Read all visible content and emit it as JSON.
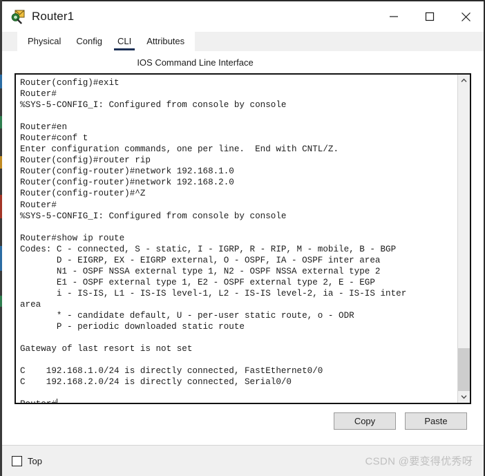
{
  "window": {
    "title": "Router1",
    "icon": "packet-tracer-device-icon",
    "controls": {
      "minimize": "minimize-icon",
      "maximize": "maximize-icon",
      "close": "close-icon"
    }
  },
  "tabs": [
    {
      "label": "Physical",
      "active": false
    },
    {
      "label": "Config",
      "active": false
    },
    {
      "label": "CLI",
      "active": true
    },
    {
      "label": "Attributes",
      "active": false
    }
  ],
  "panel": {
    "heading": "IOS Command Line Interface"
  },
  "terminal": {
    "lines": [
      "Router(config)#exit",
      "Router#",
      "%SYS-5-CONFIG_I: Configured from console by console",
      "",
      "Router#en",
      "Router#conf t",
      "Enter configuration commands, one per line.  End with CNTL/Z.",
      "Router(config)#router rip",
      "Router(config-router)#network 192.168.1.0",
      "Router(config-router)#network 192.168.2.0",
      "Router(config-router)#^Z",
      "Router#",
      "%SYS-5-CONFIG_I: Configured from console by console",
      "",
      "Router#show ip route",
      "Codes: C - connected, S - static, I - IGRP, R - RIP, M - mobile, B - BGP",
      "       D - EIGRP, EX - EIGRP external, O - OSPF, IA - OSPF inter area",
      "       N1 - OSPF NSSA external type 1, N2 - OSPF NSSA external type 2",
      "       E1 - OSPF external type 1, E2 - OSPF external type 2, E - EGP",
      "       i - IS-IS, L1 - IS-IS level-1, L2 - IS-IS level-2, ia - IS-IS inter",
      "area",
      "       * - candidate default, U - per-user static route, o - ODR",
      "       P - periodic downloaded static route",
      "",
      "Gateway of last resort is not set",
      "",
      "C    192.168.1.0/24 is directly connected, FastEthernet0/0",
      "C    192.168.2.0/24 is directly connected, Serial0/0",
      "",
      "Router#"
    ],
    "prompt_last": "Router#",
    "scrollbar": {
      "up_arrow": "chevron-up-icon",
      "down_arrow": "chevron-down-icon"
    }
  },
  "buttons": {
    "copy": "Copy",
    "paste": "Paste"
  },
  "footer": {
    "top_checkbox_label": "Top",
    "top_checked": false,
    "watermark": "CSDN @要变得优秀呀"
  },
  "colors": {
    "tab_underline": "#1c3055",
    "terminal_border": "#121212",
    "scroll_thumb": "#cdcdcd",
    "footer_bg": "#f0f0f0",
    "button_bg": "#e2e2e2",
    "watermark": "#bfbfbf"
  }
}
